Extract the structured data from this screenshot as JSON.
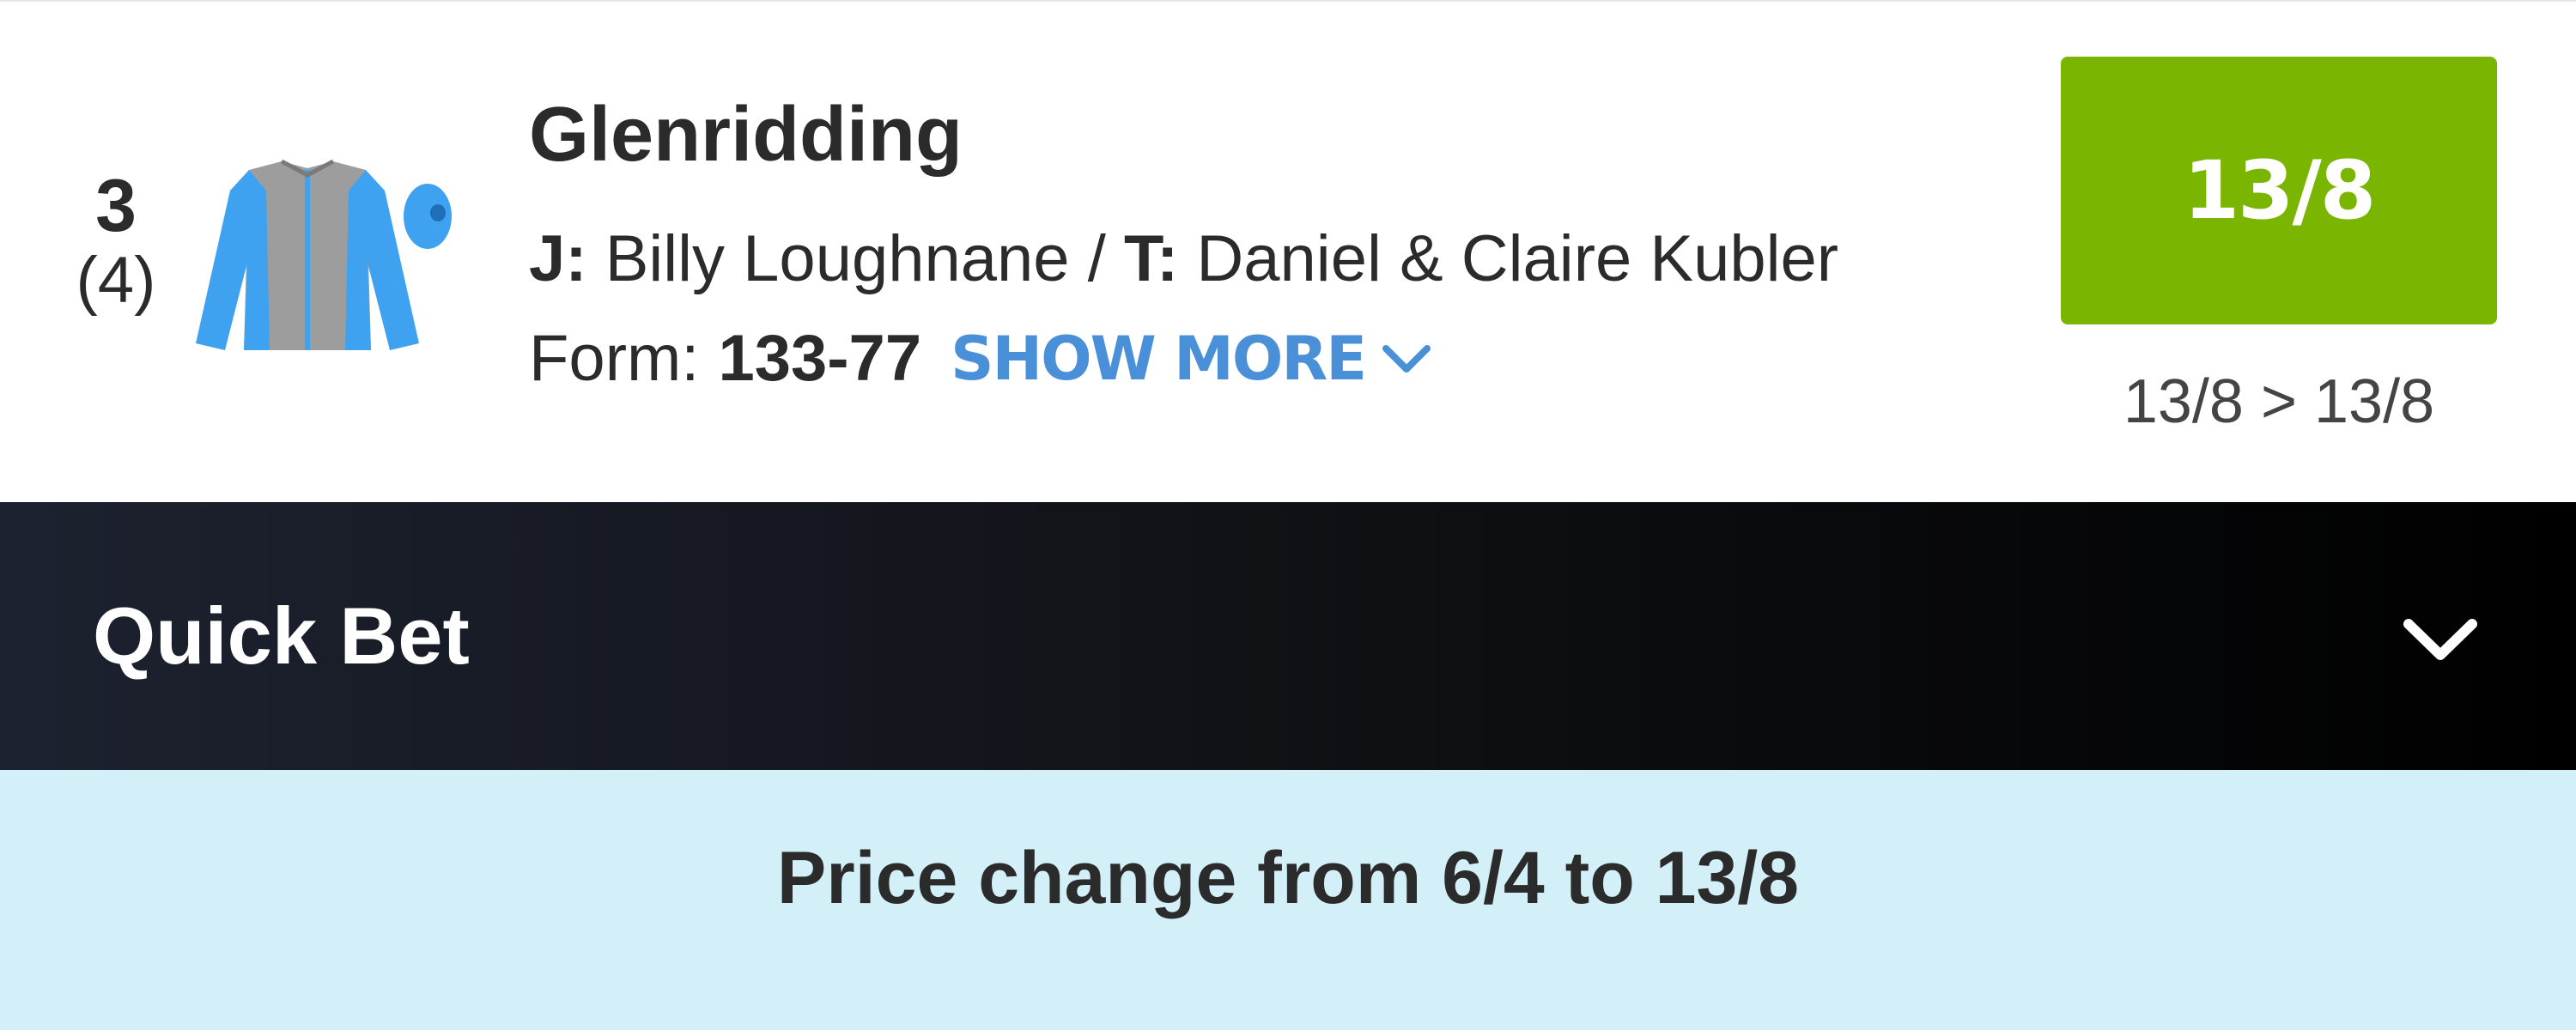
{
  "runner": {
    "saddle_number": "3",
    "draw": "(4)",
    "silk_icon": "jockey-silk-icon",
    "silk_colors": {
      "body": "#9d9d9d",
      "sleeves": "#3ea2f0",
      "cap": "#3ea2f0"
    },
    "name": "Glenridding",
    "jockey_label": "J:",
    "jockey": "Billy Loughnane",
    "separator": "/",
    "trainer_label": "T:",
    "trainer": "Daniel & Claire Kubler",
    "form_label": "Form:",
    "form_value": "133-77",
    "show_more_label": "SHOW MORE",
    "show_more_icon": "chevron-down-icon",
    "odds": "13/8",
    "odds_color": "#7ab502",
    "price_history": "13/8 > 13/8"
  },
  "quick_bet": {
    "title": "Quick Bet",
    "toggle_icon": "chevron-down-icon"
  },
  "notice": {
    "text": "Price change from 6/4 to 13/8",
    "background": "#d3f0f8"
  },
  "colors": {
    "accent_link": "#4a90d9",
    "text_primary": "#2b2b2b"
  }
}
